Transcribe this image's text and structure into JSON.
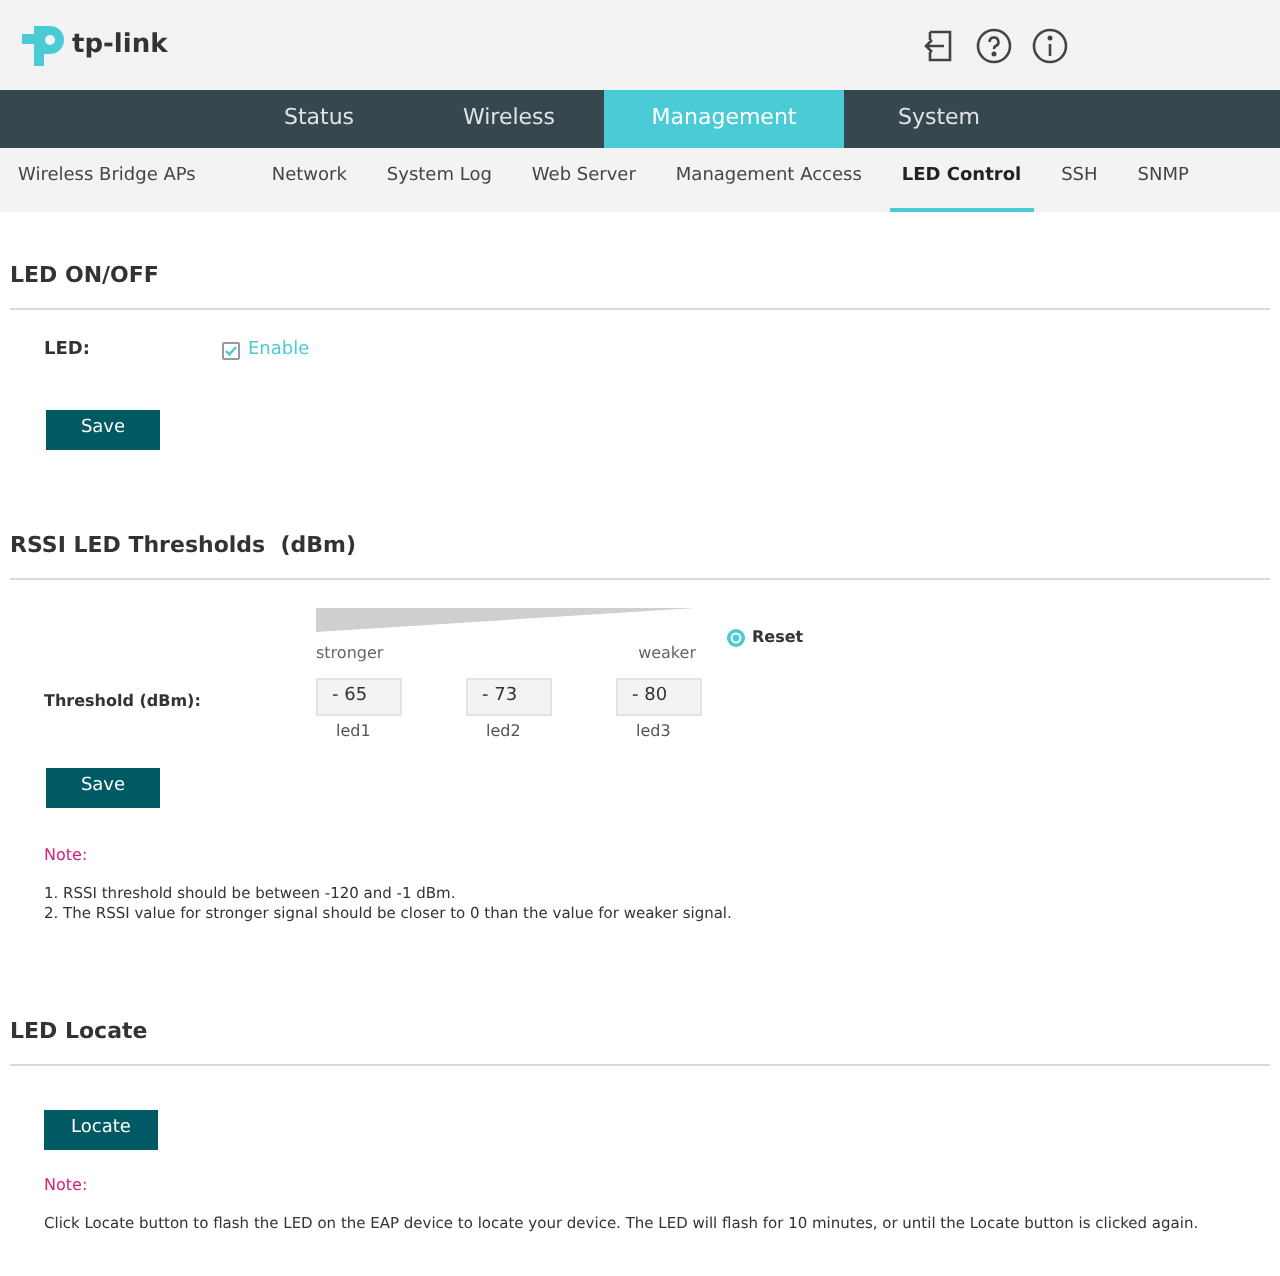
{
  "logo": {
    "text": "tp-link"
  },
  "nav_tabs": [
    {
      "label": "Status",
      "selected": false
    },
    {
      "label": "Wireless",
      "selected": false
    },
    {
      "label": "Management",
      "selected": true
    },
    {
      "label": "System",
      "selected": false
    }
  ],
  "sub_tabs": [
    {
      "label": "Wireless Bridge APs",
      "selected": false
    },
    {
      "label": "Network",
      "selected": false
    },
    {
      "label": "System Log",
      "selected": false
    },
    {
      "label": "Web Server",
      "selected": false
    },
    {
      "label": "Management Access",
      "selected": false
    },
    {
      "label": "LED Control",
      "selected": true
    },
    {
      "label": "SSH",
      "selected": false
    },
    {
      "label": "SNMP",
      "selected": false
    }
  ],
  "led_section": {
    "title": "LED ON/OFF",
    "field_label": "LED:",
    "checkbox": {
      "label": "Enable",
      "checked": true
    },
    "save": "Save"
  },
  "rssi_section": {
    "title": "RSSI LED Thresholds  (dBm)",
    "reset": "Reset",
    "stronger": "stronger",
    "weaker": "weaker",
    "field_label": "Threshold (dBm):",
    "thresholds": [
      {
        "value": "- 65",
        "label": "led1"
      },
      {
        "value": "- 73",
        "label": "led2"
      },
      {
        "value": "- 80",
        "label": "led3"
      }
    ],
    "save": "Save",
    "note_title": "Note:",
    "notes": [
      "1. RSSI threshold should be between -120 and -1 dBm.",
      "2. The RSSI value for stronger signal should be closer to 0 than the value for weaker signal."
    ]
  },
  "locate_section": {
    "title": "LED Locate",
    "button": "Locate",
    "note_title": "Note:",
    "note": "Click Locate button to flash the LED on the EAP device to locate your device. The LED will flash for 10 minutes, or until the Locate button is clicked again."
  }
}
